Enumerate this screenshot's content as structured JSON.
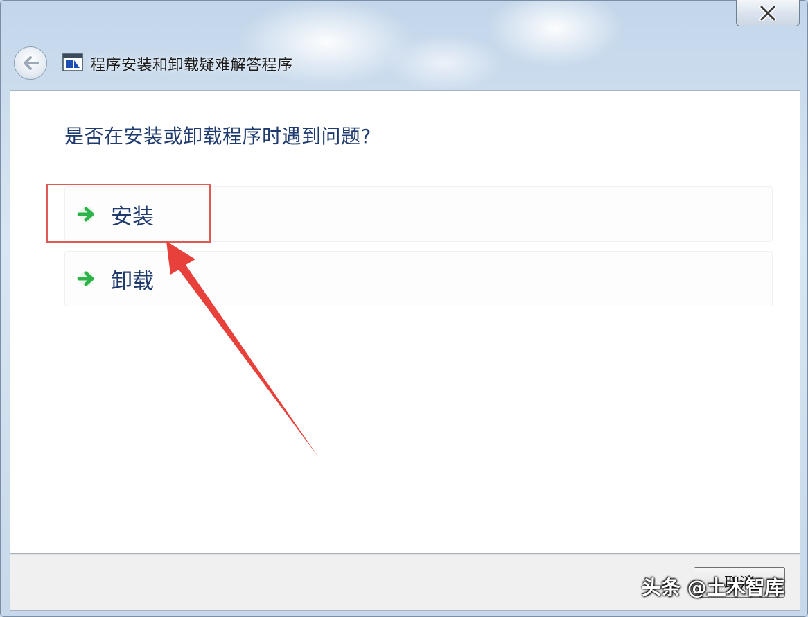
{
  "window": {
    "title": "程序安装和卸载疑难解答程序",
    "close_icon": "close-icon",
    "back_icon": "back-arrow-icon"
  },
  "main": {
    "question": "是否在安装或卸载程序时遇到问题?",
    "options": [
      {
        "label": "安装",
        "icon": "green-arrow-right-icon"
      },
      {
        "label": "卸载",
        "icon": "green-arrow-right-icon"
      }
    ],
    "highlight_color": "#e05a55"
  },
  "footer": {
    "cancel_label": "取消"
  },
  "watermark": {
    "text": "头条 @土木智库"
  },
  "colors": {
    "heading": "#1e3a6e",
    "arrow_green": "#2bb34a",
    "annotation_red": "#e8403a"
  }
}
